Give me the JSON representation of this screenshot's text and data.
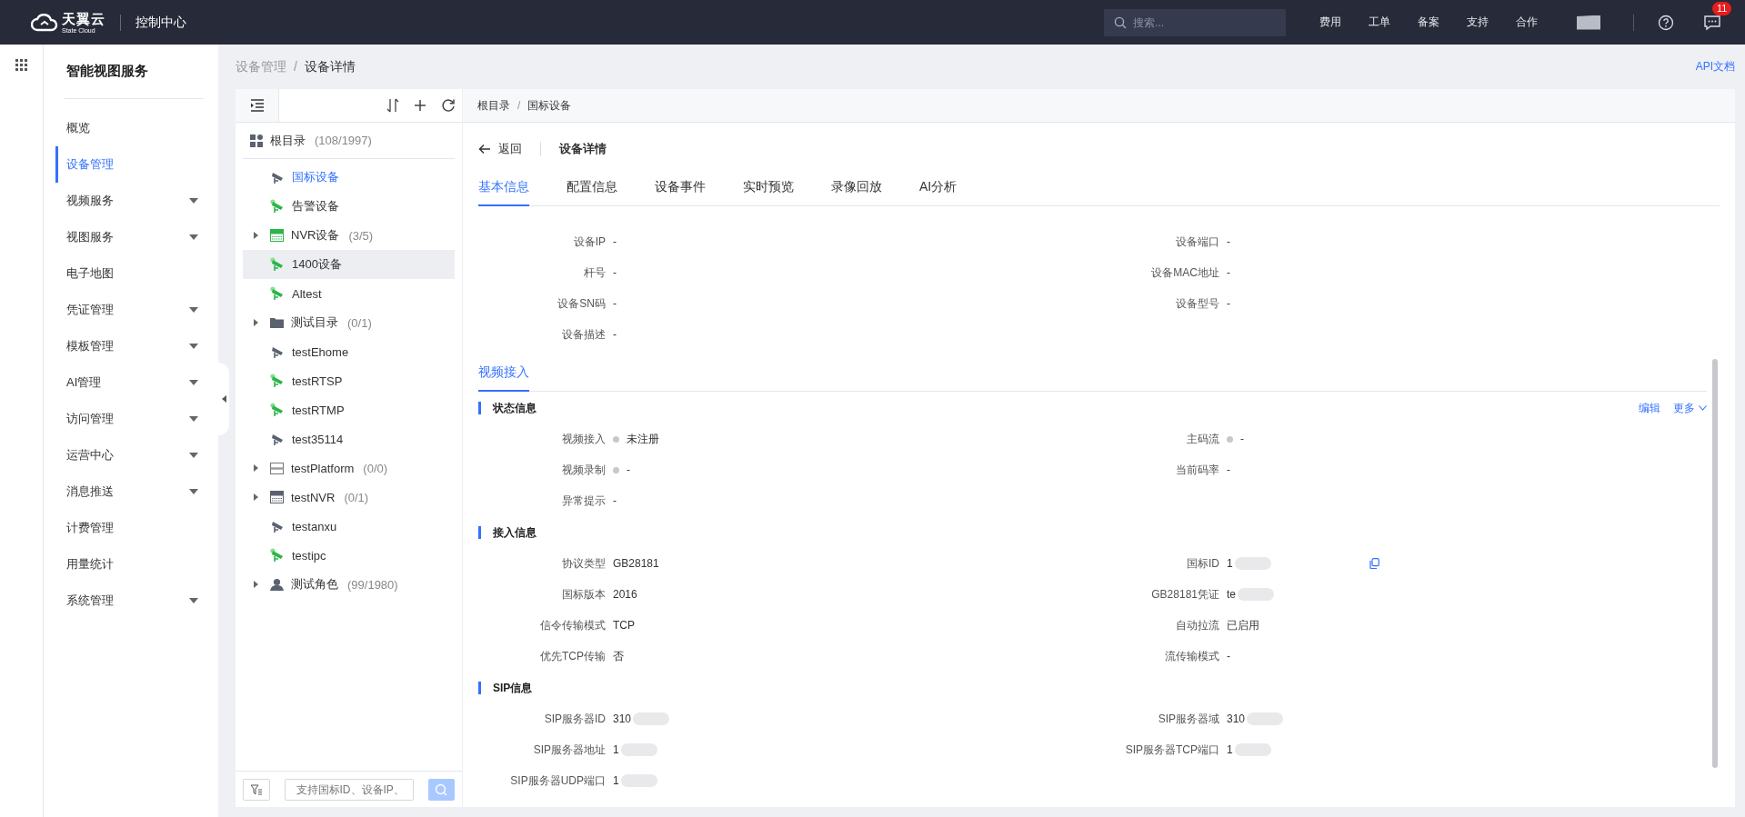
{
  "topbar": {
    "brand": "天翼云",
    "brand_sub": "State Cloud",
    "console": "控制中心",
    "search": {
      "placeholder": "搜索..."
    },
    "links": [
      "费用",
      "工单",
      "备案",
      "支持",
      "合作"
    ],
    "message_badge": "11"
  },
  "sidebar": {
    "title": "智能视图服务",
    "items": [
      {
        "label": "概览",
        "expandable": false,
        "selected": false
      },
      {
        "label": "设备管理",
        "expandable": false,
        "selected": true
      },
      {
        "label": "视频服务",
        "expandable": true,
        "selected": false
      },
      {
        "label": "视图服务",
        "expandable": true,
        "selected": false
      },
      {
        "label": "电子地图",
        "expandable": false,
        "selected": false
      },
      {
        "label": "凭证管理",
        "expandable": true,
        "selected": false
      },
      {
        "label": "模板管理",
        "expandable": true,
        "selected": false
      },
      {
        "label": "AI管理",
        "expandable": true,
        "selected": false
      },
      {
        "label": "访问管理",
        "expandable": true,
        "selected": false
      },
      {
        "label": "运营中心",
        "expandable": true,
        "selected": false
      },
      {
        "label": "消息推送",
        "expandable": true,
        "selected": false
      },
      {
        "label": "计费管理",
        "expandable": false,
        "selected": false
      },
      {
        "label": "用量统计",
        "expandable": false,
        "selected": false
      },
      {
        "label": "系统管理",
        "expandable": true,
        "selected": false
      }
    ]
  },
  "breadcrumb": {
    "separator": "/",
    "items": [
      "设备管理",
      "设备详情"
    ]
  },
  "api_link": "API文档",
  "tree": {
    "root": {
      "label": "根目录",
      "count": "(108/1997)"
    },
    "items": [
      {
        "kind": "camera-offline",
        "label": "国标设备",
        "expandable": false,
        "selected": true,
        "hovered": false
      },
      {
        "kind": "camera-online",
        "label": "告警设备",
        "expandable": false,
        "selected": false,
        "hovered": false
      },
      {
        "kind": "nvr-online",
        "label": "NVR设备",
        "count": "(3/5)",
        "expandable": true,
        "selected": false,
        "hovered": false
      },
      {
        "kind": "camera-online",
        "label": "1400设备",
        "expandable": false,
        "selected": false,
        "hovered": true
      },
      {
        "kind": "camera-online",
        "label": "Altest",
        "expandable": false,
        "selected": false,
        "hovered": false
      },
      {
        "kind": "folder",
        "label": "测试目录",
        "count": "(0/1)",
        "expandable": true,
        "selected": false,
        "hovered": false
      },
      {
        "kind": "camera-offline",
        "label": "testEhome",
        "expandable": false,
        "selected": false,
        "hovered": false
      },
      {
        "kind": "camera-online",
        "label": "testRTSP",
        "expandable": false,
        "selected": false,
        "hovered": false
      },
      {
        "kind": "camera-online",
        "label": "testRTMP",
        "expandable": false,
        "selected": false,
        "hovered": false
      },
      {
        "kind": "camera-offline",
        "label": "test35114",
        "expandable": false,
        "selected": false,
        "hovered": false
      },
      {
        "kind": "platform",
        "label": "testPlatform",
        "count": "(0/0)",
        "expandable": true,
        "selected": false,
        "hovered": false
      },
      {
        "kind": "nvr-offline",
        "label": "testNVR",
        "count": "(0/1)",
        "expandable": true,
        "selected": false,
        "hovered": false
      },
      {
        "kind": "camera-offline",
        "label": "testanxu",
        "expandable": false,
        "selected": false,
        "hovered": false
      },
      {
        "kind": "camera-online",
        "label": "testipc",
        "expandable": false,
        "selected": false,
        "hovered": false
      },
      {
        "kind": "role",
        "label": "测试角色",
        "count": "(99/1980)",
        "expandable": true,
        "selected": false,
        "hovered": false
      }
    ],
    "search": {
      "placeholder": "支持国标ID、设备IP、"
    }
  },
  "detail": {
    "path": {
      "separator": "/",
      "items": [
        "根目录",
        "国标设备"
      ]
    },
    "back": "返回",
    "title": "设备详情",
    "tabs": [
      {
        "label": "基本信息",
        "selected": true
      },
      {
        "label": "配置信息",
        "selected": false
      },
      {
        "label": "设备事件",
        "selected": false
      },
      {
        "label": "实时预览",
        "selected": false
      },
      {
        "label": "录像回放",
        "selected": false
      },
      {
        "label": "AI分析",
        "selected": false
      }
    ],
    "basic_rows": [
      [
        {
          "label": "设备IP",
          "value": "-"
        },
        {
          "label": "设备端口",
          "value": "-"
        }
      ],
      [
        {
          "label": "杆号",
          "value": "-"
        },
        {
          "label": "设备MAC地址",
          "value": "-"
        }
      ],
      [
        {
          "label": "设备SN码",
          "value": "-"
        },
        {
          "label": "设备型号",
          "value": "-"
        }
      ],
      [
        {
          "label": "设备描述",
          "value": "-"
        }
      ]
    ],
    "sub_tabs": [
      {
        "label": "视频接入",
        "selected": true
      }
    ],
    "sections": [
      {
        "title": "状态信息",
        "actions": [
          "编辑",
          "更多"
        ],
        "rows": [
          [
            {
              "label": "视频接入",
              "value": "未注册",
              "color": "#c8c8c8"
            },
            {
              "label": "主码流",
              "value": "-",
              "color": "#c8c8c8"
            }
          ],
          [
            {
              "label": "视频录制",
              "value": "-",
              "color": "#c8c8c8"
            },
            {
              "label": "当前码率",
              "value": "-"
            }
          ],
          [
            {
              "label": "异常提示",
              "value": "-"
            }
          ]
        ]
      },
      {
        "title": "接入信息",
        "rows": [
          [
            {
              "label": "协议类型",
              "value": "GB28181"
            },
            {
              "label": "国标ID",
              "value": "1",
              "redacted": true,
              "copyable": true
            }
          ],
          [
            {
              "label": "国标版本",
              "value": "2016"
            },
            {
              "label": "GB28181凭证",
              "value": "te",
              "redacted": true
            }
          ],
          [
            {
              "label": "信令传输模式",
              "value": "TCP"
            },
            {
              "label": "自动拉流",
              "value": "已启用"
            }
          ],
          [
            {
              "label": "优先TCP传输",
              "value": "否"
            },
            {
              "label": "流传输模式",
              "value": "-"
            }
          ]
        ]
      },
      {
        "title": "SIP信息",
        "rows": [
          [
            {
              "label": "SIP服务器ID",
              "value": "310",
              "redacted": true
            },
            {
              "label": "SIP服务器域",
              "value": "310",
              "redacted": true
            }
          ],
          [
            {
              "label": "SIP服务器地址",
              "value": "1",
              "redacted": true
            },
            {
              "label": "SIP服务器TCP端口",
              "value": "1",
              "redacted": true
            }
          ],
          [
            {
              "label": "SIP服务器UDP端口",
              "value": "1",
              "redacted": true
            }
          ]
        ]
      }
    ]
  }
}
